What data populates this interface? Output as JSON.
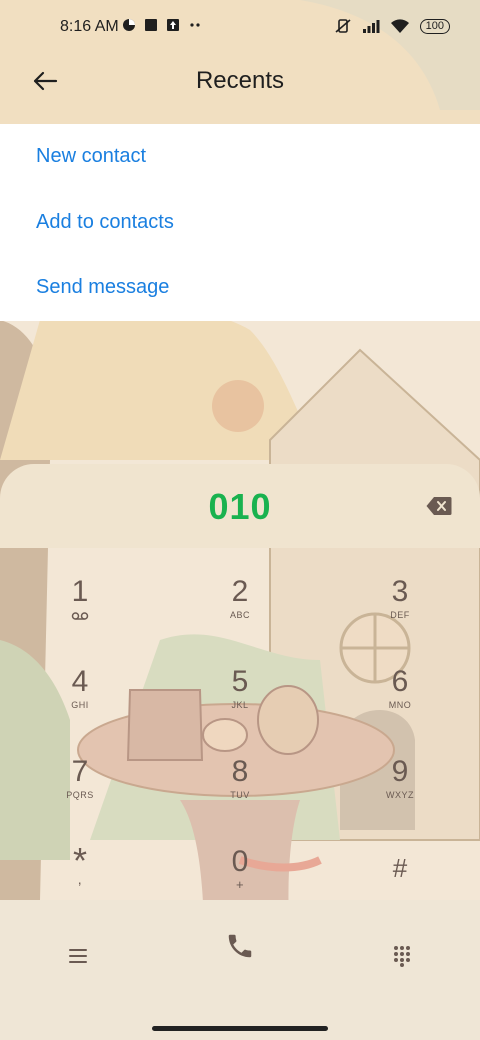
{
  "status_bar": {
    "time": "8:16 AM",
    "left_icons": [
      "data-saver-icon",
      "square-notification-icon",
      "upload-notification-icon",
      "more-dots-icon"
    ],
    "right_icons": [
      "vibrate-muted-icon",
      "signal-icon",
      "wifi-icon"
    ],
    "battery": "100"
  },
  "header": {
    "title": "Recents",
    "back_icon": "back-arrow-icon"
  },
  "menu": {
    "items": [
      {
        "label": "New contact"
      },
      {
        "label": "Add to contacts"
      },
      {
        "label": "Send message"
      }
    ]
  },
  "dialer": {
    "number": "010",
    "keys": [
      {
        "digit": "1",
        "letters": ""
      },
      {
        "digit": "2",
        "letters": "ABC"
      },
      {
        "digit": "3",
        "letters": "DEF"
      },
      {
        "digit": "4",
        "letters": "GHI"
      },
      {
        "digit": "5",
        "letters": "JKL"
      },
      {
        "digit": "6",
        "letters": "MNO"
      },
      {
        "digit": "7",
        "letters": "PQRS"
      },
      {
        "digit": "8",
        "letters": "TUV"
      },
      {
        "digit": "9",
        "letters": "WXYZ"
      },
      {
        "digit": "*",
        "letters": ","
      },
      {
        "digit": "0",
        "letters": "+"
      },
      {
        "digit": "#",
        "letters": ""
      }
    ]
  },
  "colors": {
    "accent_blue": "#1a7fe0",
    "number_green": "#19b24f",
    "key_text": "#6a5a52"
  }
}
